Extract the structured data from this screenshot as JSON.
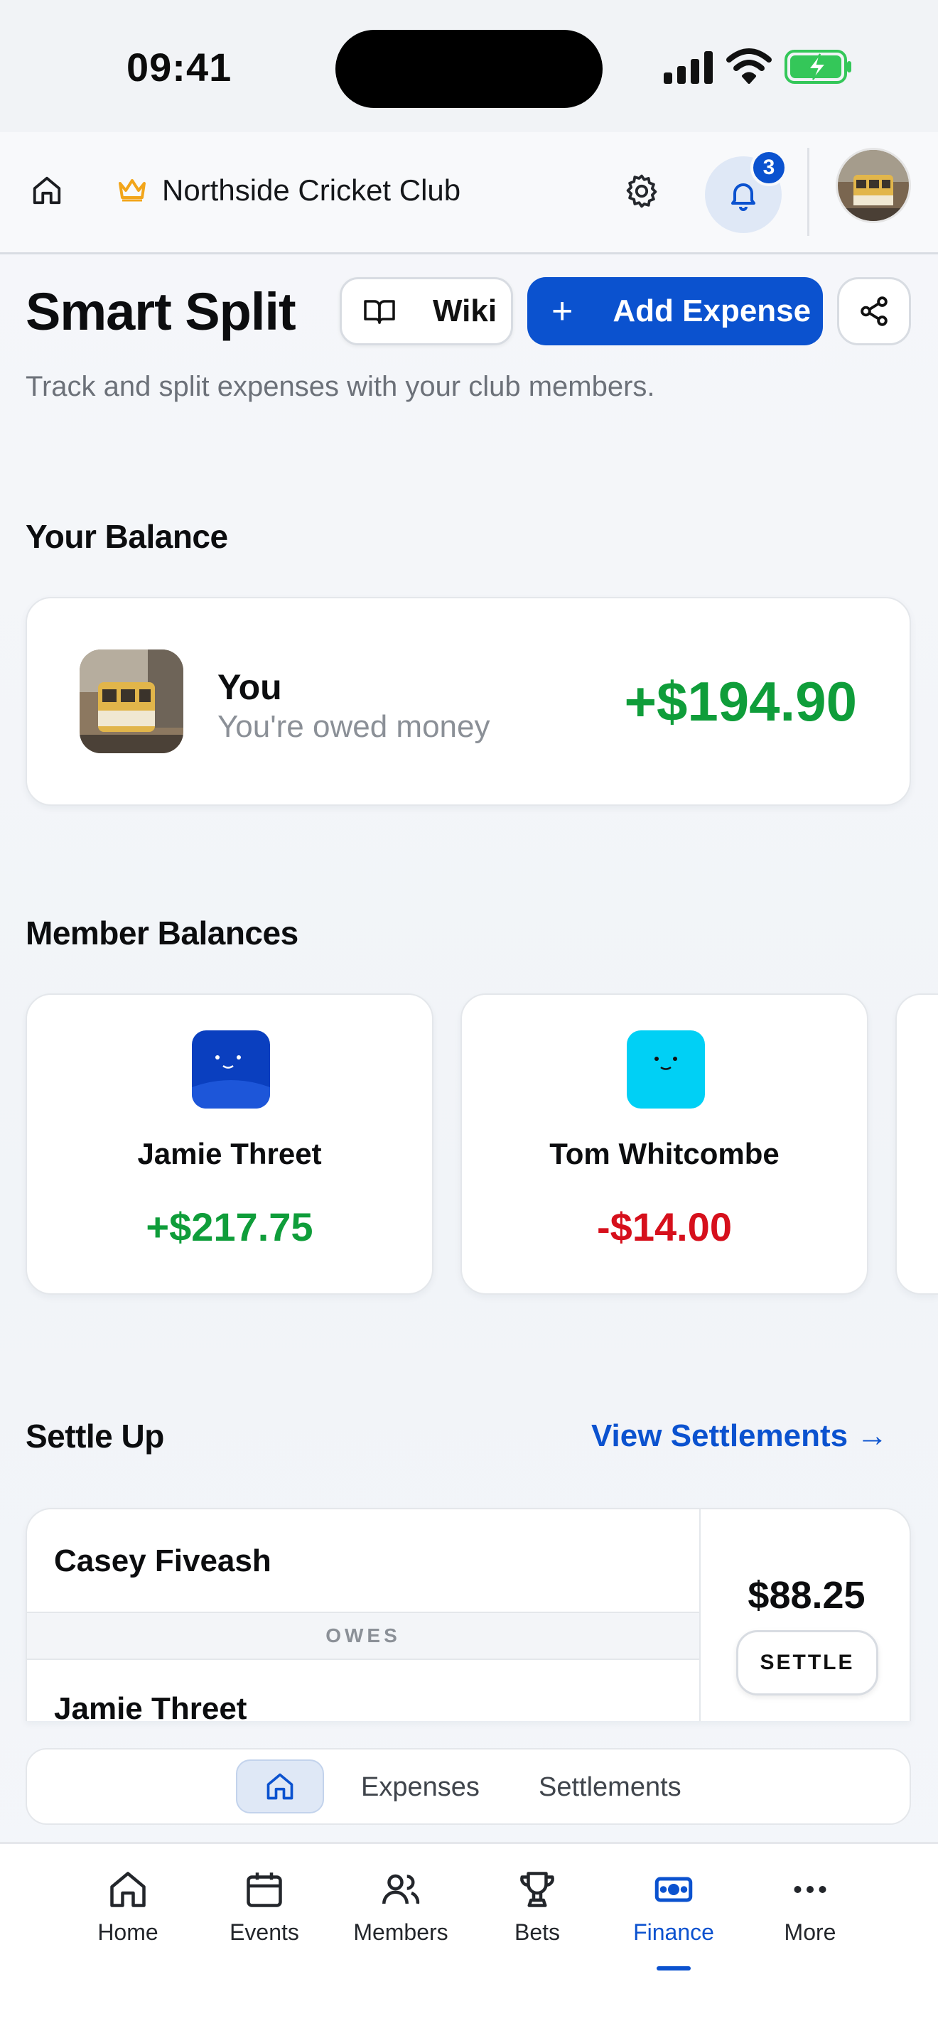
{
  "status_bar": {
    "time": "09:41"
  },
  "header": {
    "club_name": "Northside Cricket Club",
    "notification_count": "3"
  },
  "page": {
    "title": "Smart Split",
    "subtitle": "Track and split expenses with your club members.",
    "wiki_label": "Wiki",
    "add_expense_label": "Add Expense"
  },
  "your_balance": {
    "heading": "Your Balance",
    "name": "You",
    "status": "You're owed money",
    "amount": "+$194.90"
  },
  "member_balances": {
    "heading": "Member Balances",
    "members": [
      {
        "name": "Jamie Threet",
        "amount": "+$217.75",
        "color": "#0f9d3a",
        "avatar_color": "#0a3fbf"
      },
      {
        "name": "Tom Whitcombe",
        "amount": "-$14.00",
        "color": "#d6101c",
        "avatar_color": "#00d0f5"
      }
    ]
  },
  "settle_up": {
    "heading": "Settle Up",
    "view_link": "View Settlements →",
    "items": [
      {
        "payer": "Casey Fiveash",
        "relation": "OWES",
        "payee": "Jamie Threet",
        "amount": "$88.25",
        "action": "SETTLE"
      }
    ]
  },
  "segmented_tabs": {
    "items": [
      "Expenses",
      "Settlements"
    ],
    "active_icon": "home-icon"
  },
  "bottom_nav": {
    "items": [
      {
        "label": "Home",
        "icon": "home-icon"
      },
      {
        "label": "Events",
        "icon": "calendar-icon"
      },
      {
        "label": "Members",
        "icon": "members-icon"
      },
      {
        "label": "Bets",
        "icon": "trophy-icon"
      },
      {
        "label": "Finance",
        "icon": "finance-icon",
        "active": true
      },
      {
        "label": "More",
        "icon": "more-icon"
      }
    ]
  },
  "colors": {
    "accent": "#0b52cf",
    "positive": "#0f9d3a",
    "negative": "#d6101c"
  }
}
